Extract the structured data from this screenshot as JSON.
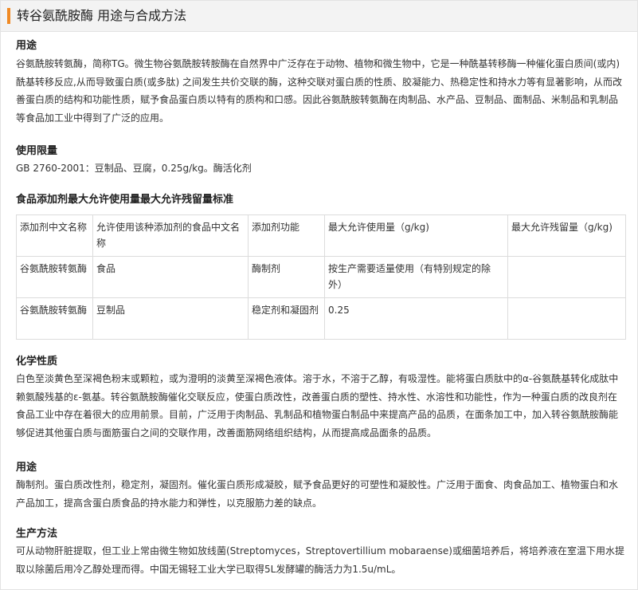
{
  "title": "转谷氨酰胺酶 用途与合成方法",
  "accent_color": "#f08a24",
  "sections": {
    "use1": {
      "heading": "用途",
      "text": "谷氨酰胺转氨酶，简称TG。微生物谷氨酰胺转胺酶在自然界中广泛存在于动物、植物和微生物中，它是一种酰基转移酶一种催化蛋白质间(或内)酰基转移反应,从而导致蛋白质(或多肽) 之间发生共价交联的酶，这种交联对蛋白质的性质、胶凝能力、热稳定性和持水力等有显著影响，从而改善蛋白质的结构和功能性质，赋予食品蛋白质以特有的质构和口感。因此谷氨酰胺转氨酶在肉制品、水产品、豆制品、面制品、米制品和乳制品等食品加工业中得到了广泛的应用。"
    },
    "limit": {
      "heading": "使用限量",
      "text": "GB 2760-2001：豆制品、豆腐，0.25g/kg。酶活化剂"
    },
    "table": {
      "heading": "食品添加剂最大允许使用量最大允许残留量标准",
      "headers": [
        "添加剂中文名称",
        "允许使用该种添加剂的食品中文名称",
        "添加剂功能",
        "最大允许使用量（g/kg)",
        "最大允许残留量（g/kg)"
      ],
      "rows": [
        [
          "谷氨酰胺转氨酶",
          "食品",
          "酶制剂",
          "按生产需要适量使用（有特别规定的除外）",
          ""
        ],
        [
          "谷氨酰胺转氨酶",
          "豆制品",
          "稳定剂和凝固剂",
          "0.25",
          ""
        ]
      ]
    },
    "chem": {
      "heading": "化学性质",
      "text": "白色至淡黄色至深褐色粉末或颗粒，或为澄明的淡黄至深褐色液体。溶于水，不溶于乙醇，有吸湿性。能将蛋白质肽中的α-谷氨酰基转化成肽中赖氨酸残基的ε-氨基。转谷氨酰胺酶催化交联反应，使蛋白质改性，改善蛋白质的塑性、持水性、水溶性和功能性，作为一种蛋白质的改良剂在食品工业中存在着很大的应用前景。目前，广泛用于肉制品、乳制品和植物蛋白制品中来提高产品的品质，在面条加工中，加入转谷氨酰胺酶能够促进其他蛋白质与面筋蛋白之间的交联作用，改善面筋网络组织结构，从而提高成品面条的品质。"
    },
    "use2": {
      "heading": "用途",
      "text": "酶制剂。蛋白质改性剂，稳定剂，凝固剂。催化蛋白质形成凝胶，赋予食品更好的可塑性和凝胶性。广泛用于面食、肉食品加工、植物蛋白和水产品加工，提高含蛋白质食品的持水能力和弹性，以克服筋力差的缺点。"
    },
    "production": {
      "heading": "生产方法",
      "text": "可从动物肝脏提取，但工业上常由微生物如放线菌(Streptomyces，Streptovertillium mobaraense)或细菌培养后，将培养液在室温下用水提取以除菌后用冷乙醇处理而得。中国无锡轻工业大学已取得5L发酵罐的酶活力为1.5u/mL。"
    }
  }
}
